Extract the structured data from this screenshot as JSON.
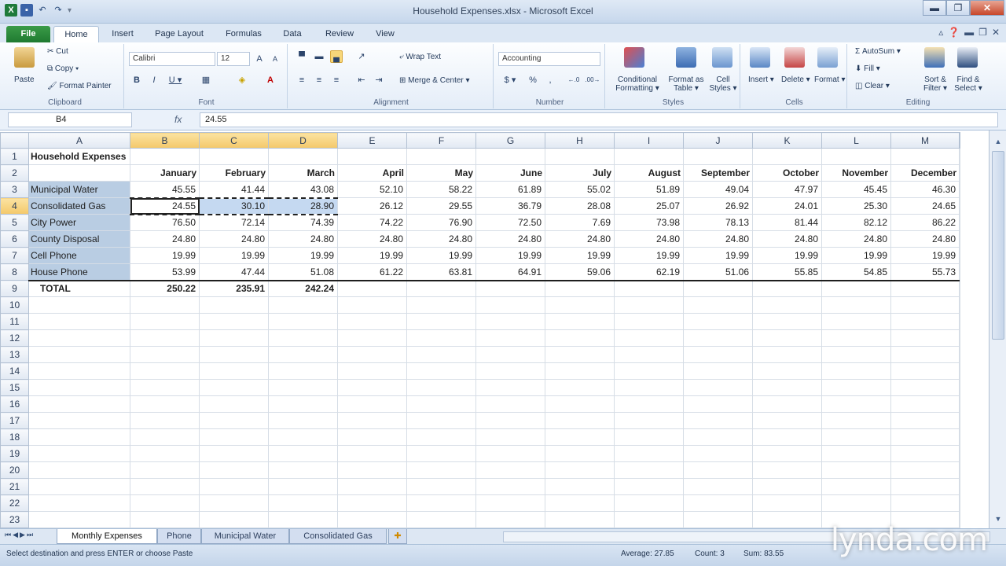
{
  "window": {
    "title": "Household Expenses.xlsx - Microsoft Excel",
    "minimize": "▬",
    "restore": "❐",
    "close": "✕"
  },
  "tabs": [
    "File",
    "Home",
    "Insert",
    "Page Layout",
    "Formulas",
    "Data",
    "Review",
    "View"
  ],
  "ribbon": {
    "clipboard": {
      "label": "Clipboard",
      "paste": "Paste",
      "cut": "Cut",
      "copy": "Copy ▾",
      "format_painter": "Format Painter"
    },
    "font": {
      "label": "Font",
      "name": "Calibri",
      "size": "12",
      "bold": "B",
      "italic": "I",
      "underline": "U ▾"
    },
    "alignment": {
      "label": "Alignment",
      "wrap_text": "Wrap Text",
      "merge_center": "Merge & Center ▾"
    },
    "number": {
      "label": "Number",
      "format": "Accounting",
      "currency": "$ ▾",
      "percent": "%",
      "comma": ",",
      "inc_decimal": "←.0",
      "dec_decimal": ".00→"
    },
    "styles": {
      "label": "Styles",
      "conditional": "Conditional Formatting ▾",
      "format_table": "Format as Table ▾",
      "cell_styles": "Cell Styles ▾"
    },
    "cells": {
      "label": "Cells",
      "insert": "Insert ▾",
      "delete": "Delete ▾",
      "format": "Format ▾"
    },
    "editing": {
      "label": "Editing",
      "autosum": "AutoSum ▾",
      "fill": "Fill ▾",
      "clear": "Clear ▾",
      "sort_filter": "Sort & Filter ▾",
      "find_select": "Find & Select ▾"
    }
  },
  "formula_bar": {
    "name_box": "B4",
    "fx": "fx",
    "value": "24.55"
  },
  "columns": [
    "A",
    "B",
    "C",
    "D",
    "E",
    "F",
    "G",
    "H",
    "I",
    "J",
    "K",
    "L",
    "M"
  ],
  "months": [
    "January",
    "February",
    "March",
    "April",
    "May",
    "June",
    "July",
    "August",
    "September",
    "October",
    "November",
    "December"
  ],
  "sheet_title": "Household Expenses",
  "rows": [
    {
      "label": "Municipal Water",
      "values": [
        "45.55",
        "41.44",
        "43.08",
        "52.10",
        "58.22",
        "61.89",
        "55.02",
        "51.89",
        "49.04",
        "47.97",
        "45.45",
        "46.30"
      ]
    },
    {
      "label": "Consolidated Gas",
      "values": [
        "24.55",
        "30.10",
        "28.90",
        "26.12",
        "29.55",
        "36.79",
        "28.08",
        "25.07",
        "26.92",
        "24.01",
        "25.30",
        "24.65"
      ]
    },
    {
      "label": "City Power",
      "values": [
        "76.50",
        "72.14",
        "74.39",
        "74.22",
        "76.90",
        "72.50",
        "7.69",
        "73.98",
        "78.13",
        "81.44",
        "82.12",
        "86.22"
      ]
    },
    {
      "label": "County Disposal",
      "values": [
        "24.80",
        "24.80",
        "24.80",
        "24.80",
        "24.80",
        "24.80",
        "24.80",
        "24.80",
        "24.80",
        "24.80",
        "24.80",
        "24.80"
      ]
    },
    {
      "label": "Cell Phone",
      "values": [
        "19.99",
        "19.99",
        "19.99",
        "19.99",
        "19.99",
        "19.99",
        "19.99",
        "19.99",
        "19.99",
        "19.99",
        "19.99",
        "19.99"
      ]
    },
    {
      "label": "House Phone",
      "values": [
        "53.99",
        "47.44",
        "51.08",
        "61.22",
        "63.81",
        "64.91",
        "59.06",
        "62.19",
        "51.06",
        "55.85",
        "54.85",
        "55.73"
      ]
    }
  ],
  "total": {
    "label": "TOTAL",
    "values": [
      "250.22",
      "235.91",
      "242.24"
    ]
  },
  "sheet_tabs": [
    "Monthly Expenses",
    "Phone",
    "Municipal Water",
    "Consolidated Gas"
  ],
  "status": {
    "message": "Select destination and press ENTER or choose Paste",
    "average": "Average: 27.85",
    "count": "Count: 3",
    "sum": "Sum: 83.55"
  },
  "watermark": "lynda.com",
  "colors": {
    "file_tab": "#1f7a30",
    "selection": "#c5d9f1",
    "header_highlight": "#f4c86a"
  }
}
